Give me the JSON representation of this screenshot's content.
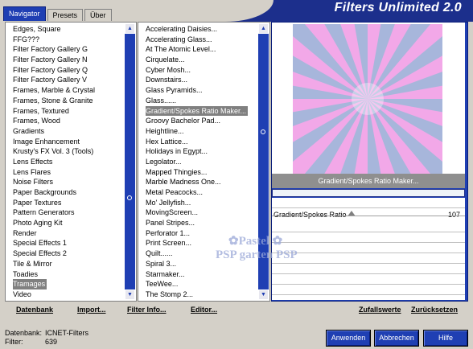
{
  "app": {
    "title": "Filters Unlimited 2.0"
  },
  "tabs": [
    {
      "label": "Navigator"
    },
    {
      "label": "Presets"
    },
    {
      "label": "Über"
    }
  ],
  "categories": {
    "items": [
      "Edges, Square",
      "FFG???",
      "Filter Factory Gallery G",
      "Filter Factory Gallery N",
      "Filter Factory Gallery Q",
      "Filter Factory Gallery V",
      "Frames, Marble & Crystal",
      "Frames, Stone & Granite",
      "Frames, Textured",
      "Frames, Wood",
      "Gradients",
      "Image Enhancement",
      "Krusty's FX Vol. 3 (Tools)",
      "Lens Effects",
      "Lens Flares",
      "Noise Filters",
      "Paper Backgrounds",
      "Paper Textures",
      "Pattern Generators",
      "Photo Aging Kit",
      "Render",
      "Special Effects 1",
      "Special Effects 2",
      "Tile & Mirror",
      "Toadies",
      "Tramages",
      "Video"
    ],
    "selected": "Tramages"
  },
  "filters": {
    "items": [
      "Accelerating Daisies...",
      "Accelerating Glass...",
      "At The Atomic Level...",
      "Cirquelate...",
      "Cyber Mosh...",
      "Downstairs...",
      "Glass Pyramids...",
      "Glass......",
      "Gradient/Spokes Ratio Maker...",
      "Groovy Bachelor Pad...",
      "Heightline...",
      "Hex Lattice...",
      "Holidays in Egypt...",
      "Legolator...",
      "Mapped Thingies...",
      "Marble Madness One...",
      "Metal Peacocks...",
      "Mo' Jellyfish...",
      "MovingScreen...",
      "Panel Stripes...",
      "Perforator 1...",
      "Print Screen...",
      "Quilt......",
      "Spiral 3...",
      "Starmaker...",
      "TeeWee...",
      "The Stomp 2..."
    ],
    "selected": "Gradient/Spokes Ratio Maker..."
  },
  "preview": {
    "filter_name": "Gradient/Spokes Ratio Maker..."
  },
  "params": {
    "label": "Gradient/Spokes Ratio",
    "value": "107",
    "value_num": 107
  },
  "watermark": {
    "line1": "Pastel",
    "line2": "garten"
  },
  "bottom_links": {
    "database": "Datenbank",
    "import": "Import...",
    "filter_info": "Filter Info...",
    "editor": "Editor...",
    "random": "Zufallswerte",
    "reset": "Zurücksetzen"
  },
  "status": {
    "db_label": "Datenbank:",
    "db_value": "ICNET-Filters",
    "filter_label": "Filter:",
    "filter_value": "639"
  },
  "buttons": {
    "apply": "Anwenden",
    "cancel": "Abbrechen",
    "help": "Hilfe"
  },
  "colors": {
    "accent": "#1f3fb3",
    "header": "#1c2f8c",
    "preview_pink": "#f2a8e8",
    "preview_blue": "#9ab8d8"
  }
}
